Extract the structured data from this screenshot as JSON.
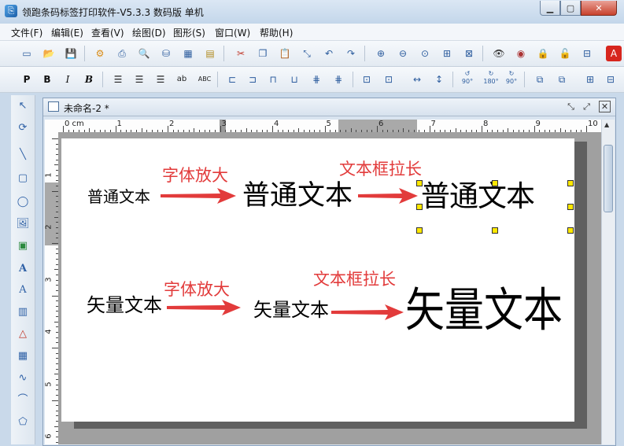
{
  "window": {
    "title": "领跑条码标签打印软件-V5.3.3 数码版 单机"
  },
  "menubar": {
    "items": [
      "文件(F)",
      "编辑(E)",
      "查看(V)",
      "绘图(D)",
      "图形(S)",
      "窗口(W)",
      "帮助(H)"
    ]
  },
  "format_toolbar": {
    "bold": "B",
    "italic": "I",
    "bold_italic": "B",
    "plain": "P",
    "abc": "ABC",
    "rotate": [
      "90°",
      "180°",
      "90°"
    ]
  },
  "document": {
    "tab_title": "未命名-2 *"
  },
  "hruler": {
    "unit": "cm",
    "labels": [
      "0 cm",
      "1",
      "2",
      "3",
      "4",
      "5",
      "6",
      "7",
      "8",
      "9",
      "10"
    ]
  },
  "vruler": {
    "labels": [
      "1",
      "2",
      "3",
      "4",
      "5",
      "6"
    ]
  },
  "canvas": {
    "row1": {
      "small": "普通文本",
      "arrow1_label": "字体放大",
      "medium": "普通文本",
      "arrow2_label": "文本框拉长",
      "stretched": "普通文本"
    },
    "row2": {
      "small": "矢量文本",
      "arrow1_label": "字体放大",
      "medium": "矢量文本",
      "arrow2_label": "文本框拉长",
      "large": "矢量文本"
    }
  },
  "colors": {
    "annotation": "#e23b3b",
    "arrow": "#e23b3b",
    "handle": "#ffe800"
  }
}
